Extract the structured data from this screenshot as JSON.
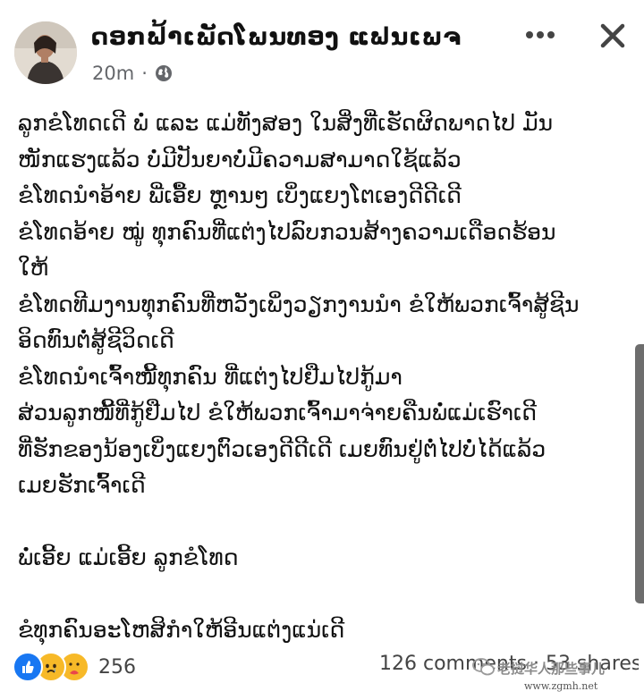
{
  "header": {
    "author_name": "ດອກຟ້າເພັດໂພນທອງ ແຟນເພຈ",
    "time_ago": "20m",
    "dot": "·",
    "privacy_icon": "globe-icon",
    "more_icon": "more-horizontal-icon",
    "close_icon": "close-icon"
  },
  "post": {
    "lines": [
      "ລູກຂໍໂທດເດີ ພໍ່ ແລະ ແມ່ທັງສອງ ໃນສິ່ງທີ່ເຮັດຜິດພາດໄປ ມັນ",
      "ໜັກແຮງແລ້ວ ບໍ່ມີປັນຍາບໍ່ມີຄວາມສາມາດໃຊ້ແລ້ວ",
      "ຂໍໂທດນຳອ້າຍ ພີ່ເອື້ຍ ຫຼານໆ ເບິ່ງແຍງໂຕເອງດີດີເດີ",
      "ຂໍໂທດອ້າຍ ໝູ່ ທຸກຄົນທີ່ແຕ່ງໄປລົບກວນສ້າງຄວາມເດືອດຮ້ອນ",
      "ໃຫ້",
      "ຂໍໂທດທີມງານທຸກຄົນທີ່ຫວັງເພິ່ງວຽກງານນຳ ຂໍໃຫ້ພວກເຈົ້າສູ້ຊີນ",
      "ອິດທົນຕໍ່ສູ້ຊີວິດເດີ",
      "ຂໍໂທດນຳເຈົ້າໜີ້ທຸກຄົນ ທີ່ແຕ່ງໄປຢືມໄປກູ້ມາ",
      "ສ່ວນລູກໜີ້ທີ່ກູ້ຢືມໄປ ຂໍໃຫ້ພວກເຈົ້າມາຈ່າຍຄືນພໍ່ແມ່ເຮົາເດີ",
      "ທີ່ຮັກຂອງນ້ອງເບິ່ງແຍງຕົວເອງດີດີເດີ ເມຍທົນຢູ່ຕໍ່ໄປບໍ່ໄດ້ແລ້ວ",
      "ເມຍຮັກເຈົ້າເດີ",
      "",
      "ພໍ່ເອີ້ຍ ແມ່ເອີ້ຍ ລູກຂໍໂທດ",
      "",
      "ຂໍທຸກຄົນອະໂຫສິກຳໃຫ້ອີນແຕ່ງແນ່ເດີ"
    ]
  },
  "footer": {
    "reaction_icons": [
      "like-icon",
      "sad-icon",
      "care-icon"
    ],
    "reaction_count": "256",
    "stats_text": "126 comments · 53 shares"
  },
  "watermark": {
    "line1": "老挝华人那些事儿",
    "line2": "www.zgmh.net"
  },
  "colors": {
    "like_blue": "#1877f2",
    "emoji_yellow": "#f7b928",
    "meta_gray": "#65676b"
  }
}
